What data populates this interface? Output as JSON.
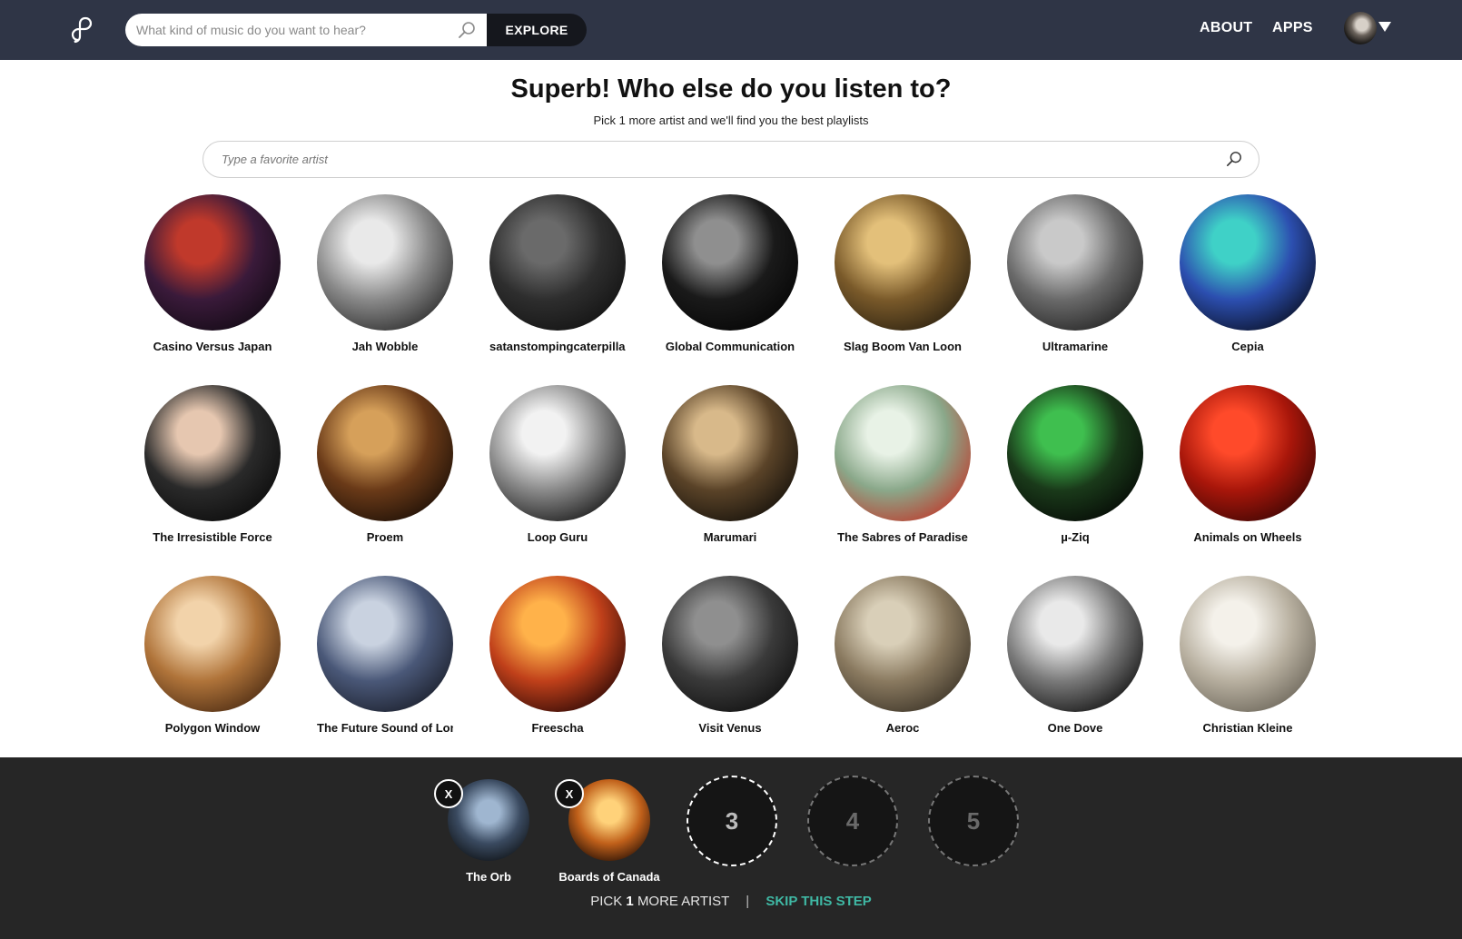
{
  "header": {
    "search_placeholder": "What kind of music do you want to hear?",
    "explore_label": "EXPLORE",
    "nav": [
      "ABOUT",
      "APPS"
    ]
  },
  "main": {
    "title": "Superb! Who else do you listen to?",
    "subtitle": "Pick 1 more artist and we'll find you the best playlists",
    "artist_search_placeholder": "Type a favorite artist",
    "artists": [
      {
        "name": "Casino Versus Japan",
        "colors": [
          "#c0392b",
          "#3a1a3a",
          "#120a14"
        ]
      },
      {
        "name": "Jah Wobble",
        "colors": [
          "#e9e9e9",
          "#8a8a8a",
          "#2a2a2a"
        ]
      },
      {
        "name": "satanstompingcaterpillars",
        "colors": [
          "#6a6a6a",
          "#2e2e2e",
          "#121212"
        ]
      },
      {
        "name": "Global Communication",
        "colors": [
          "#8f8f8f",
          "#1a1a1a",
          "#050505"
        ]
      },
      {
        "name": "Slag Boom Van Loon",
        "colors": [
          "#e3c07a",
          "#7a5a2a",
          "#2a2010"
        ]
      },
      {
        "name": "Ultramarine",
        "colors": [
          "#c9c9c9",
          "#6a6a6a",
          "#222222"
        ]
      },
      {
        "name": "Cepia",
        "colors": [
          "#3fd1c7",
          "#2c4fb0",
          "#0a1024"
        ]
      },
      {
        "name": "The Irresistible Force",
        "colors": [
          "#e6c7b0",
          "#2a2a2a",
          "#0b0b0b"
        ]
      },
      {
        "name": "Proem",
        "colors": [
          "#d6a05a",
          "#6a3a18",
          "#1a0e06"
        ]
      },
      {
        "name": "Loop Guru",
        "colors": [
          "#f2f2f2",
          "#8a8a8a",
          "#151515"
        ]
      },
      {
        "name": "Marumari",
        "colors": [
          "#d8b98a",
          "#5a4328",
          "#14100a"
        ]
      },
      {
        "name": "The Sabres of Paradise",
        "colors": [
          "#e8f2e6",
          "#8aa88a",
          "#c0392b"
        ]
      },
      {
        "name": "µ-Ziq",
        "colors": [
          "#3fbf4f",
          "#1a3a1a",
          "#050805"
        ]
      },
      {
        "name": "Animals on Wheels",
        "colors": [
          "#ff4a2a",
          "#a8160a",
          "#3a0604"
        ]
      },
      {
        "name": "Polygon Window",
        "colors": [
          "#f2d3aa",
          "#b0743a",
          "#4a2a12"
        ]
      },
      {
        "name": "The Future Sound of London",
        "colors": [
          "#c9d2e0",
          "#4a5878",
          "#1a1e2a"
        ]
      },
      {
        "name": "Freescha",
        "colors": [
          "#ffb24a",
          "#c0401a",
          "#2a0806"
        ]
      },
      {
        "name": "Visit Venus",
        "colors": [
          "#8f8f8f",
          "#3a3a3a",
          "#101010"
        ]
      },
      {
        "name": "Aeroc",
        "colors": [
          "#d9cfb8",
          "#8a7a60",
          "#3a3226"
        ]
      },
      {
        "name": "One Dove",
        "colors": [
          "#e9e9e9",
          "#7a7a7a",
          "#101010"
        ]
      },
      {
        "name": "Christian Kleine",
        "colors": [
          "#f4f1ea",
          "#b8b0a0",
          "#6a6458"
        ]
      }
    ]
  },
  "tray": {
    "selected": [
      {
        "name": "The Orb",
        "colors": [
          "#9fb6d0",
          "#3a4a60",
          "#101418"
        ]
      },
      {
        "name": "Boards of Canada",
        "colors": [
          "#ffd27a",
          "#c0601a",
          "#2a1206"
        ]
      }
    ],
    "remove_label": "X",
    "empty_slots": [
      "3",
      "4",
      "5"
    ],
    "status": {
      "prefix": "PICK",
      "count": "1",
      "suffix": "MORE ARTIST",
      "separator": "|",
      "skip_label": "SKIP THIS STEP"
    }
  }
}
